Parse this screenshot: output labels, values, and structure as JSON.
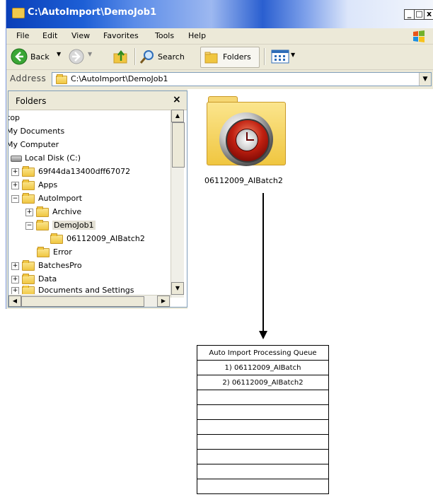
{
  "window": {
    "title": "C:\\AutoImport\\DemoJob1",
    "buttons": {
      "minimize": "_",
      "maximize": "□",
      "close": "x"
    }
  },
  "menu": [
    "File",
    "Edit",
    "View",
    "Favorites",
    "Tools",
    "Help"
  ],
  "toolbar": {
    "back_label": "Back",
    "search_label": "Search",
    "folders_label": "Folders"
  },
  "address": {
    "label": "Address",
    "value": "C:\\AutoImport\\DemoJob1"
  },
  "folders_pane": {
    "title": "Folders",
    "close": "×",
    "tree": [
      {
        "label": "top",
        "expander": ""
      },
      {
        "label": "My Documents",
        "expander": ""
      },
      {
        "label": "My Computer",
        "expander": ""
      },
      {
        "label": "Local Disk (C:)",
        "expander": ""
      },
      {
        "label": "69f44da13400dff67072",
        "expander": "+"
      },
      {
        "label": "Apps",
        "expander": "+"
      },
      {
        "label": "AutoImport",
        "expander": "−"
      },
      {
        "label": "Archive",
        "expander": "+"
      },
      {
        "label": "DemoJob1",
        "expander": "−"
      },
      {
        "label": "06112009_AIBatch2",
        "expander": ""
      },
      {
        "label": "Error",
        "expander": ""
      },
      {
        "label": "BatchesPro",
        "expander": "+"
      },
      {
        "label": "Data",
        "expander": "+"
      },
      {
        "label": "Documents and Settings",
        "expander": "+"
      }
    ]
  },
  "content": {
    "item_label": "06112009_AIBatch2"
  },
  "queue": {
    "header": "Auto Import Processing Queue",
    "rows": [
      "1) 06112009_AIBatch",
      "2) 06112009_AIBatch2",
      "",
      "",
      "",
      "",
      "",
      "",
      ""
    ]
  },
  "colors": {
    "titlebar": "#1d5fd6",
    "window_bg": "#ece9d8",
    "folder": "#f0c640"
  }
}
